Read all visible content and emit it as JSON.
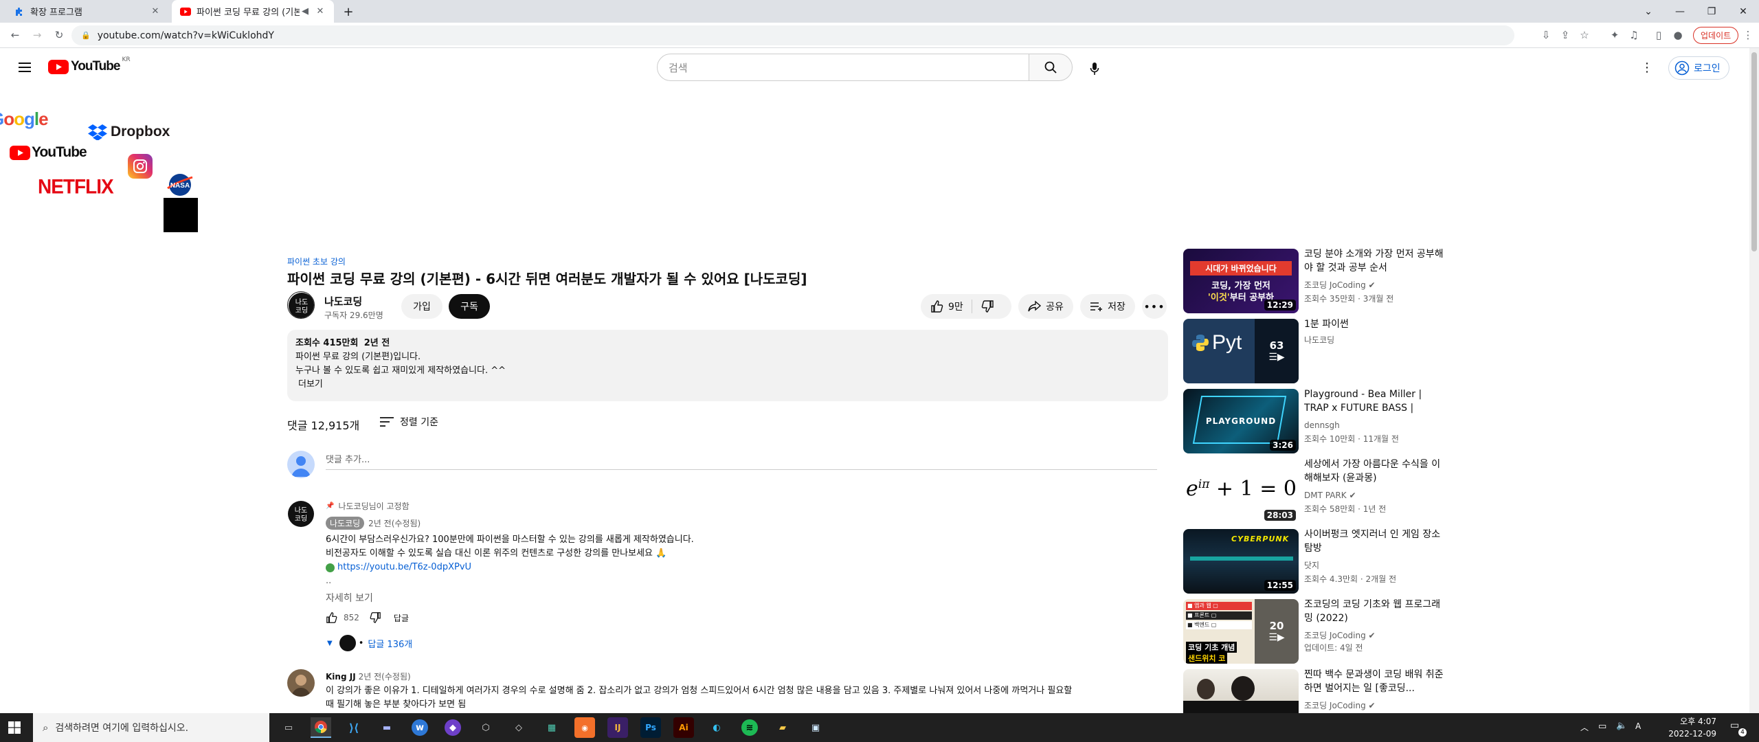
{
  "browser": {
    "tabs": [
      {
        "title": "확장 프로그램",
        "active": false
      },
      {
        "title": "파이썬 코딩 무료 강의 (기본",
        "active": true
      }
    ],
    "url": "youtube.com/watch?v=kWiCuklohdY",
    "update_label": "업데이트"
  },
  "youtube": {
    "logo_text": "YouTube",
    "region": "KR",
    "search_placeholder": "검색",
    "login_label": "로그인"
  },
  "extension_logos": [
    "Google",
    "Dropbox",
    "YouTube",
    "NETFLIX",
    "NASA"
  ],
  "video": {
    "hashtag": "파이썬 초보 강의",
    "title": "파이썬 코딩 무료 강의 (기본편) - 6시간 뒤면 여러분도 개발자가 될 수 있어요 [나도코딩]",
    "channel": "나도코딩",
    "subscribers": "구독자 29.6만명",
    "join_label": "가입",
    "subscribe_label": "구독",
    "likes": "9만",
    "share_label": "공유",
    "save_label": "저장",
    "description": {
      "views": "조회수 415만회",
      "date": "2년 전",
      "line1": "파이썬 무료 강의 (기본편)입니다.",
      "line2": "누구나 볼 수 있도록 쉽고 재미있게 제작하였습니다. ^^",
      "more": "더보기"
    }
  },
  "comments": {
    "count_label": "댓글 12,915개",
    "sort_label": "정렬 기준",
    "add_placeholder": "댓글 추가...",
    "pinned": {
      "pinned_label": "나도코딩님이 고정함",
      "author": "나도코딩",
      "time": "2년 전(수정됨)",
      "line1": "6시간이 부담스러우신가요? 100분만에 파이썬을 마스터할 수 있는 강의를 새롭게 제작하였습니다.",
      "line2": "비전공자도 이해할 수 있도록 실습 대신 이론 위주의 컨텐츠로 구성한 강의를 만나보세요 🙏",
      "link": "https://youtu.be/T6z-0dpXPvU",
      "ellipsis": "..",
      "read_more": "자세히 보기",
      "likes": "852",
      "reply_label": "답글",
      "replies_label": "답글 136개"
    },
    "second": {
      "author": "King JJ",
      "time": "2년 전(수정됨)",
      "line1": "이 강의가 좋은 이유가 1. 디테일하게 여러가지 경우의 수로 설명해 줌 2. 잡소리가 없고 강의가 엄청 스피드있어서 6시간 엄청 많은 내용을 담고 있음 3. 주제별로 나눠져 있어서 나중에 까먹거나 필요할",
      "line2": "때 필기해 놓은 부분 찾아다가 보면 됨"
    }
  },
  "related": [
    {
      "title": "코딩 분야 소개와 가장 먼저 공부해야 할 것과 공부 순서",
      "channel": "조코딩 JoCoding",
      "verified": true,
      "meta": "조회수 35만회 · 3개월 전",
      "duration": "12:29",
      "thumb_text": "시대가 바뀌었습니다 코딩, 가장 먼저 '이것'부터 공부"
    },
    {
      "title": "1분 파이썬",
      "channel": "나도코딩",
      "verified": false,
      "meta": "",
      "duration": "",
      "playlist_count": "63",
      "thumb_text": "Python"
    },
    {
      "title": "Playground - Bea Miller | TRAP x FUTURE BASS | dennsgh arca...",
      "channel": "dennsgh",
      "verified": false,
      "meta": "조회수 10만회 · 11개월 전",
      "duration": "3:26",
      "thumb_text": "PLAYGROUND"
    },
    {
      "title": "세상에서 가장 아름다운 수식을 이해해보자 (윤과몽)",
      "channel": "DMT PARK",
      "verified": true,
      "meta": "조회수 58만회 · 1년 전",
      "duration": "28:03",
      "thumb_text": "e^iπ + 1 = 0"
    },
    {
      "title": "사이버펑크 엣지러너 인 게임 장소 탐방",
      "channel": "닷지",
      "verified": false,
      "meta": "조회수 4.3만회 · 2개월 전",
      "duration": "12:55",
      "thumb_text": "CYBERPUNK"
    },
    {
      "title": "조코딩의 코딩 기초와 웹 프로그래밍 (2022)",
      "channel": "조코딩 JoCoding",
      "verified": true,
      "meta": "업데이트: 4일 전",
      "duration": "",
      "playlist_count": "20",
      "thumb_text": "코딩 기초 개념 샌드위치 코"
    },
    {
      "title": "찐따 백수 문과생이 코딩 배워 취준하면 벌어지는 일 [좋코딩...",
      "channel": "조코딩 JoCoding",
      "verified": true,
      "meta": "",
      "duration": "",
      "thumb_text": ""
    }
  ],
  "taskbar": {
    "search_placeholder": "검색하려면 여기에 입력하십시오.",
    "time": "오후 4:07",
    "date": "2022-12-09",
    "notif_count": "4"
  }
}
